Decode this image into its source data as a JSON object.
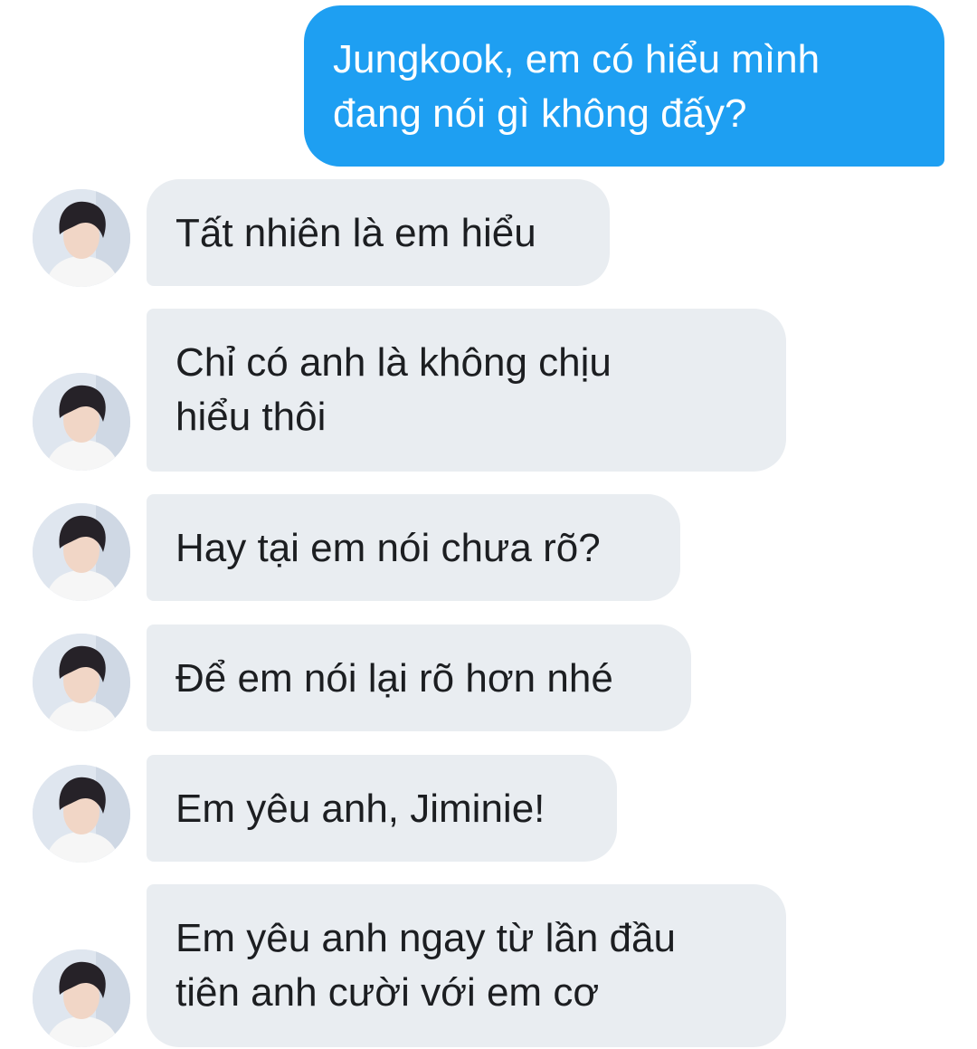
{
  "conversation": {
    "sent": [
      {
        "text": "Jungkook, em có hiểu mình\nđang nói gì không đấy?"
      }
    ],
    "received": [
      {
        "text": "Tất nhiên là em hiểu"
      },
      {
        "text": "Chỉ có anh là không chịu\nhiểu thôi"
      },
      {
        "text": "Hay tại em nói chưa rõ?"
      },
      {
        "text": "Để em nói lại rõ hơn nhé"
      },
      {
        "text": "Em yêu anh, Jiminie!"
      },
      {
        "text": "Em yêu anh ngay từ lần đầu\ntiên anh cười với em cơ"
      }
    ]
  },
  "colors": {
    "sent_bubble": "#1e9ff2",
    "received_bubble": "#e9edf1",
    "sent_text": "#ffffff",
    "received_text": "#1c1e21"
  },
  "icons": {
    "avatar": "contact-avatar-photo"
  }
}
